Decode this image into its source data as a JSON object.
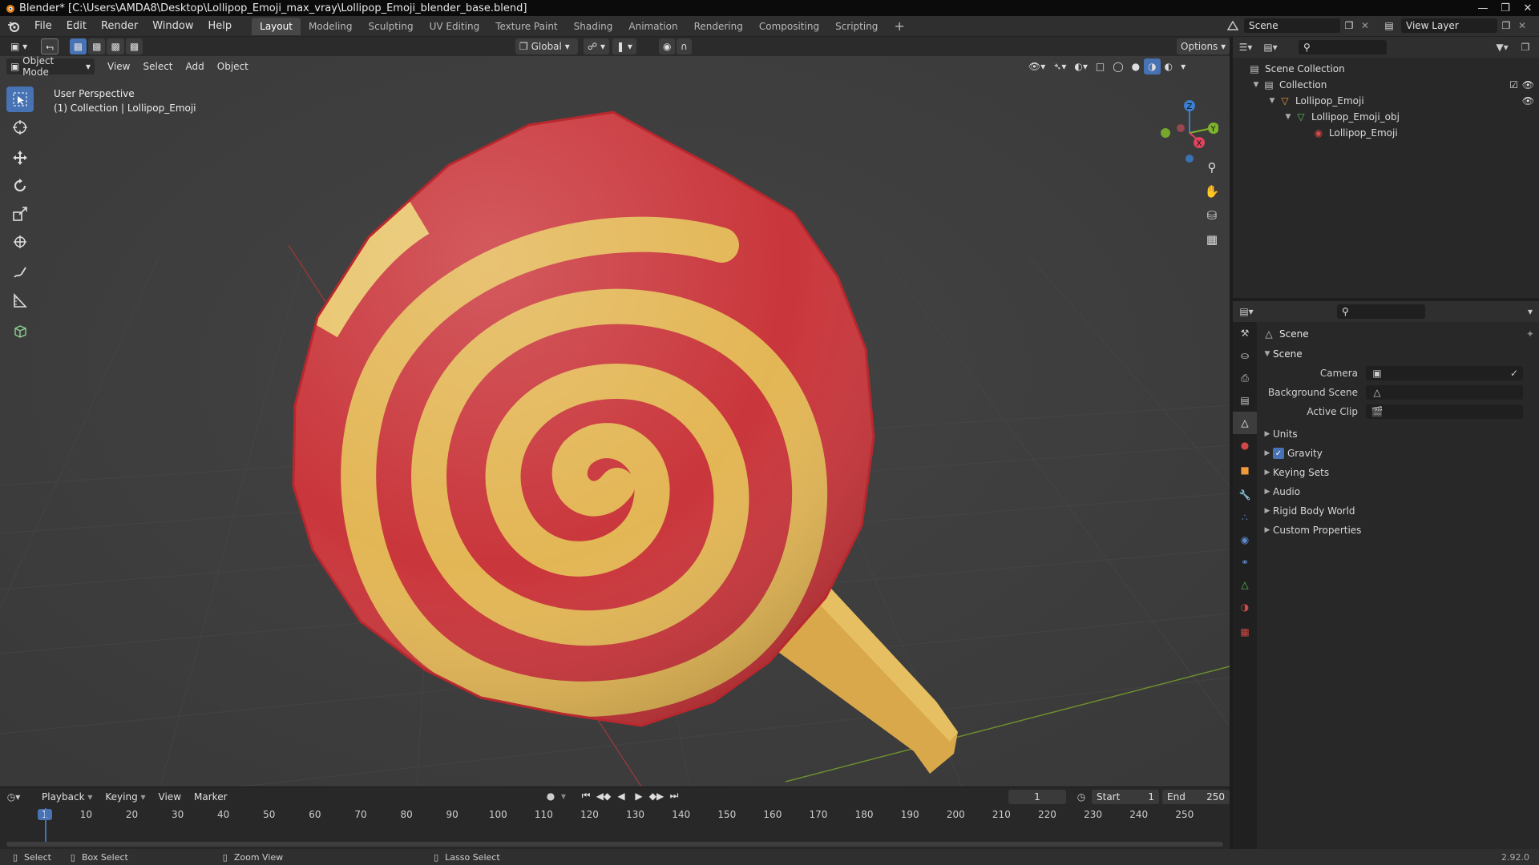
{
  "window": {
    "title": "Blender* [C:\\Users\\AMDA8\\Desktop\\Lollipop_Emoji_max_vray\\Lollipop_Emoji_blender_base.blend]"
  },
  "menu": [
    "File",
    "Edit",
    "Render",
    "Window",
    "Help"
  ],
  "workspaces": [
    {
      "label": "Layout",
      "active": true
    },
    {
      "label": "Modeling"
    },
    {
      "label": "Sculpting"
    },
    {
      "label": "UV Editing"
    },
    {
      "label": "Texture Paint"
    },
    {
      "label": "Shading"
    },
    {
      "label": "Animation"
    },
    {
      "label": "Rendering"
    },
    {
      "label": "Compositing"
    },
    {
      "label": "Scripting"
    }
  ],
  "add_workspace": "+",
  "scene_field": "Scene",
  "view_layer_field": "View Layer",
  "viewport": {
    "transform_orientation": "Global",
    "options_label": "Options",
    "mode": "Object Mode",
    "menus": [
      "View",
      "Select",
      "Add",
      "Object"
    ],
    "perspective_label": "User Perspective",
    "collection_label": "(1) Collection | Lollipop_Emoji",
    "gizmo": {
      "x": "X",
      "y": "Y",
      "z": "Z"
    }
  },
  "outliner": {
    "items": [
      {
        "label": "Scene Collection",
        "indent": 0,
        "icon": "scene-collection-icon"
      },
      {
        "label": "Collection",
        "indent": 1,
        "icon": "collection-icon"
      },
      {
        "label": "Lollipop_Emoji",
        "indent": 2,
        "icon": "object-icon"
      },
      {
        "label": "Lollipop_Emoji_obj",
        "indent": 3,
        "icon": "mesh-icon"
      },
      {
        "label": "Lollipop_Emoji",
        "indent": 4,
        "icon": "material-icon"
      }
    ]
  },
  "properties": {
    "header": "Scene",
    "section": "Scene",
    "rows": [
      {
        "label": "Camera",
        "value": ""
      },
      {
        "label": "Background Scene",
        "value": ""
      },
      {
        "label": "Active Clip",
        "value": ""
      }
    ],
    "subpanels": [
      {
        "label": "Units"
      },
      {
        "label": "Gravity",
        "checkbox": true
      },
      {
        "label": "Keying Sets"
      },
      {
        "label": "Audio"
      },
      {
        "label": "Rigid Body World"
      },
      {
        "label": "Custom Properties"
      }
    ]
  },
  "timeline": {
    "menus": [
      "Playback",
      "Keying",
      "View",
      "Marker"
    ],
    "current_frame": "1",
    "start_label": "Start",
    "start": "1",
    "end_label": "End",
    "end": "250",
    "ticks": [
      "1",
      "10",
      "20",
      "30",
      "40",
      "50",
      "60",
      "70",
      "80",
      "90",
      "100",
      "110",
      "120",
      "130",
      "140",
      "150",
      "160",
      "170",
      "180",
      "190",
      "200",
      "210",
      "220",
      "230",
      "240",
      "250"
    ]
  },
  "status": {
    "select": "Select",
    "box_select": "Box Select",
    "zoom_view": "Zoom View",
    "lasso_select": "Lasso Select",
    "version": "2.92.0"
  },
  "colors": {
    "accent": "#4772b3",
    "lollipop_red": "#c9363b",
    "lollipop_yellow": "#e3b655",
    "stick": "#e0b24f"
  }
}
